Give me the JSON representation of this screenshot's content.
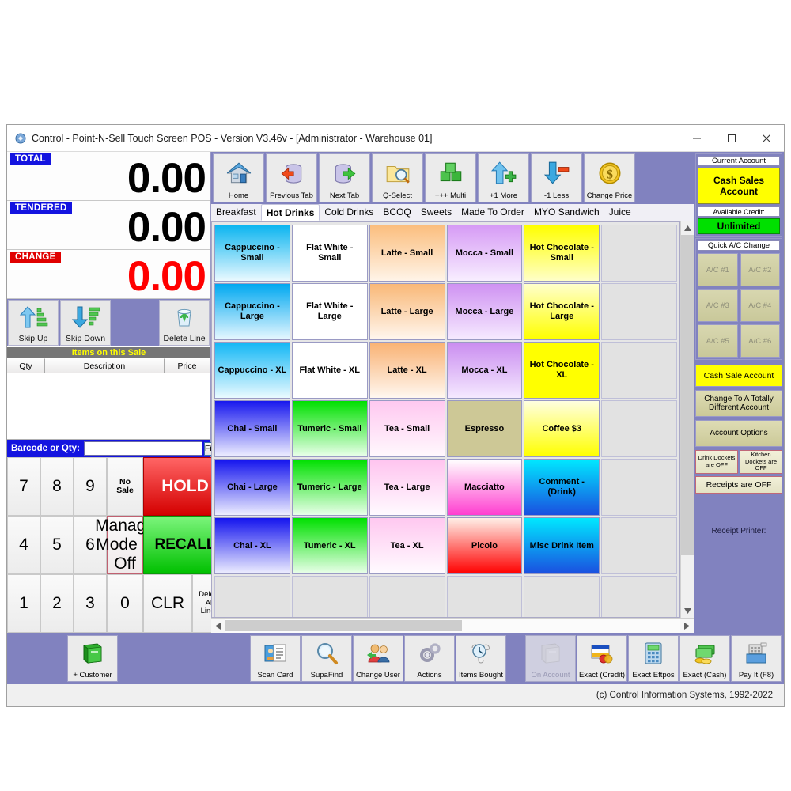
{
  "window": {
    "title": "Control - Point-N-Sell Touch Screen POS - Version V3.46v - [Administrator - Warehouse 01]",
    "minimize": "—",
    "maximize": "□",
    "close": "×"
  },
  "amounts": {
    "total_label": "TOTAL",
    "total_value": "0.00",
    "tendered_label": "TENDERED",
    "tendered_value": "0.00",
    "change_label": "CHANGE",
    "change_value": "0.00",
    "change_color": "#ff0000"
  },
  "skip_bar": {
    "skip_up": "Skip Up",
    "skip_down": "Skip Down",
    "delete_line": "Delete Line"
  },
  "sale_list": {
    "title": "Items on this Sale",
    "columns": [
      "Qty",
      "Description",
      "Price"
    ],
    "rows": []
  },
  "barcode": {
    "label": "Barcode or Qty:",
    "value": "",
    "placeholder": "",
    "find_label": "Find"
  },
  "keypad": {
    "keys": [
      {
        "label": "7",
        "style": "num"
      },
      {
        "label": "8",
        "style": "num"
      },
      {
        "label": "9",
        "style": "num"
      },
      {
        "label": "No\nSale",
        "style": "small"
      },
      {
        "label": "HOLD",
        "style": "hold"
      },
      {
        "label": "4",
        "style": "num"
      },
      {
        "label": "5",
        "style": "num"
      },
      {
        "label": "6",
        "style": "num"
      },
      {
        "label": "Manage\nMode is\nOff",
        "style": "manage"
      },
      {
        "label": "RECALL",
        "style": "recall"
      },
      {
        "label": "1",
        "style": "num"
      },
      {
        "label": "2",
        "style": "num"
      },
      {
        "label": "3",
        "style": "num"
      },
      {
        "label": "0",
        "style": "num"
      },
      {
        "label": "CLR",
        "style": "clr"
      },
      {
        "label": "Delete\nAll\nLines",
        "style": "tiny"
      }
    ]
  },
  "toolbar": {
    "buttons": [
      {
        "label": "Home",
        "icon": "house-icon"
      },
      {
        "label": "Previous Tab",
        "icon": "database-left-arrow-icon"
      },
      {
        "label": "Next Tab",
        "icon": "database-right-arrow-icon"
      },
      {
        "label": "Q-Select",
        "icon": "folder-magnifier-icon"
      },
      {
        "label": "+++ Multi",
        "icon": "green-cubes-icon"
      },
      {
        "label": "+1 More",
        "icon": "up-arrow-plus-icon"
      },
      {
        "label": "-1 Less",
        "icon": "down-arrow-minus-icon"
      },
      {
        "label": "Change Price",
        "icon": "dollar-coin-icon"
      }
    ]
  },
  "tabs": {
    "items": [
      "Breakfast",
      "Hot Drinks",
      "Cold Drinks",
      "BCOQ",
      "Sweets",
      "Made To Order",
      "MYO Sandwich",
      "Juice"
    ],
    "active": "Hot Drinks"
  },
  "product_grid": {
    "columns": 6,
    "rows": 7,
    "buttons": [
      {
        "label": "Cappuccino - Small",
        "color_top": "#0cb5f0",
        "color_bottom": "#eaf9ff",
        "text": "#000000"
      },
      {
        "label": "Flat White - Small",
        "color_top": "#ffffff",
        "color_bottom": "#ffffff",
        "text": "#000000"
      },
      {
        "label": "Latte - Small",
        "color_top": "#fbbe7e",
        "color_bottom": "#fff4e8",
        "text": "#000000"
      },
      {
        "label": "Mocca - Small",
        "color_top": "#d69bf5",
        "color_bottom": "#f8eeff",
        "text": "#000000"
      },
      {
        "label": "Hot Chocolate - Small",
        "color_top": "#ffff00",
        "color_bottom": "#ffffc8",
        "text": "#000000"
      },
      {
        "label": "",
        "color_top": "",
        "color_bottom": "",
        "text": ""
      },
      {
        "label": "Cappuccino - Large",
        "color_top": "#00a8f0",
        "color_bottom": "#e6f7ff",
        "text": "#000000"
      },
      {
        "label": "Flat White - Large",
        "color_top": "#ffffff",
        "color_bottom": "#ffffff",
        "text": "#000000"
      },
      {
        "label": "Latte - Large",
        "color_top": "#f9b877",
        "color_bottom": "#fff6ee",
        "text": "#000000"
      },
      {
        "label": "Mocca - Large",
        "color_top": "#cf92f2",
        "color_bottom": "#f6eaff",
        "text": "#000000"
      },
      {
        "label": "Hot Chocolate - Large",
        "color_top": "#ffffcc",
        "color_bottom": "#ffff00",
        "text": "#000000"
      },
      {
        "label": "",
        "color_top": "",
        "color_bottom": "",
        "text": ""
      },
      {
        "label": "Cappuccino - XL",
        "color_top": "#12b7f5",
        "color_bottom": "#eafaff",
        "text": "#000000"
      },
      {
        "label": "Flat White - XL",
        "color_top": "#ffffff",
        "color_bottom": "#ffffff",
        "text": "#000000"
      },
      {
        "label": "Latte - XL",
        "color_top": "#f9b273",
        "color_bottom": "#fff7f0",
        "text": "#000000"
      },
      {
        "label": "Mocca - XL",
        "color_top": "#ca8df0",
        "color_bottom": "#f5e9ff",
        "text": "#000000"
      },
      {
        "label": "Hot Chocolate - XL",
        "color_top": "#ffff00",
        "color_bottom": "#ffff00",
        "text": "#000000"
      },
      {
        "label": "",
        "color_top": "",
        "color_bottom": "",
        "text": ""
      },
      {
        "label": "Chai - Small",
        "color_top": "#1818ee",
        "color_bottom": "#eeeeff",
        "text": "#000000"
      },
      {
        "label": "Tumeric - Small",
        "color_top": "#00e000",
        "color_bottom": "#eaffea",
        "text": "#000000"
      },
      {
        "label": "Tea - Small",
        "color_top": "#ffc8f0",
        "color_bottom": "#fff8fd",
        "text": "#000000"
      },
      {
        "label": "Espresso",
        "color_top": "#cdc896",
        "color_bottom": "#cdc896",
        "text": "#000000"
      },
      {
        "label": "Coffee $3",
        "color_top": "#ffffe0",
        "color_bottom": "#ffff00",
        "text": "#000000"
      },
      {
        "label": "",
        "color_top": "",
        "color_bottom": "",
        "text": ""
      },
      {
        "label": "Chai - Large",
        "color_top": "#1414ee",
        "color_bottom": "#ededff",
        "text": "#000000"
      },
      {
        "label": "Tumeric - Large",
        "color_top": "#00e000",
        "color_bottom": "#e9ffe9",
        "text": "#000000"
      },
      {
        "label": "Tea - Large",
        "color_top": "#ffc4ef",
        "color_bottom": "#fffaff",
        "text": "#000000"
      },
      {
        "label": "Macciatto",
        "color_top": "#ffffff",
        "color_bottom": "#ff3fd0",
        "text": "#000000"
      },
      {
        "label": "Comment - (Drink)",
        "color_top": "#00e8ff",
        "color_bottom": "#1a4fe0",
        "text": "#000000"
      },
      {
        "label": "",
        "color_top": "",
        "color_bottom": "",
        "text": ""
      },
      {
        "label": "Chai - XL",
        "color_top": "#1414ee",
        "color_bottom": "#eeeeff",
        "text": "#000000"
      },
      {
        "label": "Tumeric - XL",
        "color_top": "#00e000",
        "color_bottom": "#eaffea",
        "text": "#000000"
      },
      {
        "label": "Tea - XL",
        "color_top": "#ffc8f0",
        "color_bottom": "#fffbff",
        "text": "#000000"
      },
      {
        "label": "Picolo",
        "color_top": "#fff0e8",
        "color_bottom": "#ff0000",
        "text": "#000000"
      },
      {
        "label": "Misc Drink Item",
        "color_top": "#00e8ff",
        "color_bottom": "#1a4fe0",
        "text": "#000000"
      },
      {
        "label": "",
        "color_top": "",
        "color_bottom": "",
        "text": ""
      },
      {
        "label": "",
        "color_top": "",
        "color_bottom": "",
        "text": ""
      },
      {
        "label": "",
        "color_top": "",
        "color_bottom": "",
        "text": ""
      },
      {
        "label": "",
        "color_top": "",
        "color_bottom": "",
        "text": ""
      },
      {
        "label": "",
        "color_top": "",
        "color_bottom": "",
        "text": ""
      },
      {
        "label": "",
        "color_top": "",
        "color_bottom": "",
        "text": ""
      },
      {
        "label": "",
        "color_top": "",
        "color_bottom": "",
        "text": ""
      }
    ]
  },
  "right_panel": {
    "current_account_label": "Current Account",
    "account_name": "Cash Sales Account",
    "available_credit_label": "Available Credit:",
    "credit_value": "Unlimited",
    "quick_change_label": "Quick A/C Change",
    "ac_buttons": [
      "A/C #1",
      "A/C #2",
      "A/C #3",
      "A/C #4",
      "A/C #5",
      "A/C #6"
    ],
    "cash_sale_account": "Cash Sale Account",
    "change_account": "Change To A Totally Different Account",
    "account_options": "Account Options",
    "drink_dockets": "Drink Dockets are OFF",
    "kitchen_dockets": "Kitchen Dockets are OFF",
    "receipts": "Receipts are OFF",
    "receipt_printer": "Receipt Printer:"
  },
  "bottom_bar": {
    "left_buttons": [
      {
        "label": "+ Customer",
        "icon": "green-book-icon",
        "disabled": false
      }
    ],
    "mid_buttons": [
      {
        "label": "Scan Card",
        "icon": "id-card-icon",
        "disabled": false
      },
      {
        "label": "SupaFind",
        "icon": "magnifier-icon",
        "disabled": false
      },
      {
        "label": "Change User",
        "icon": "users-icon",
        "disabled": false
      },
      {
        "label": "Actions",
        "icon": "gears-icon",
        "disabled": false
      },
      {
        "label": "Items Bought",
        "icon": "clock-scroll-icon",
        "disabled": false
      }
    ],
    "right_buttons": [
      {
        "label": "On Account",
        "icon": "grey-book-icon",
        "disabled": true
      },
      {
        "label": "Exact (Credit)",
        "icon": "credit-card-icon",
        "disabled": false
      },
      {
        "label": "Exact Eftpos",
        "icon": "eftpos-terminal-icon",
        "disabled": false
      },
      {
        "label": "Exact (Cash)",
        "icon": "cash-icon",
        "disabled": false
      },
      {
        "label": "Pay It (F8)",
        "icon": "cash-register-icon",
        "disabled": false
      }
    ]
  },
  "status_bar": {
    "copyright": "(c) Control Information Systems, 1992-2022"
  }
}
